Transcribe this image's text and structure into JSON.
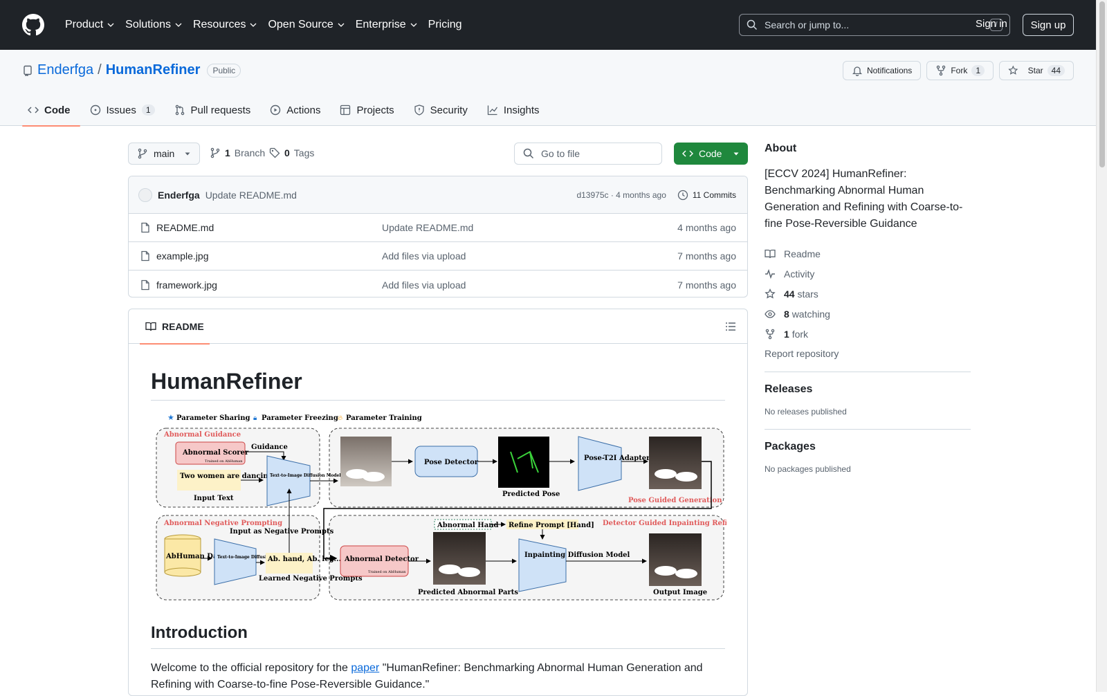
{
  "header": {
    "nav": [
      "Product",
      "Solutions",
      "Resources",
      "Open Source",
      "Enterprise",
      "Pricing"
    ],
    "search_placeholder": "Search or jump to...",
    "search_kbd": "/",
    "signin": "Sign in",
    "signup": "Sign up"
  },
  "repo": {
    "owner": "Enderfga",
    "name": "HumanRefiner",
    "visibility": "Public",
    "notifications_label": "Notifications",
    "fork_label": "Fork",
    "fork_count": "1",
    "star_label": "Star",
    "star_count": "44",
    "tabs": [
      {
        "label": "Code",
        "count": ""
      },
      {
        "label": "Issues",
        "count": "1"
      },
      {
        "label": "Pull requests",
        "count": ""
      },
      {
        "label": "Actions",
        "count": ""
      },
      {
        "label": "Projects",
        "count": ""
      },
      {
        "label": "Security",
        "count": ""
      },
      {
        "label": "Insights",
        "count": ""
      }
    ]
  },
  "branch": {
    "name": "main",
    "branch_count": "1",
    "branch_label": "Branch",
    "tag_count": "0",
    "tag_label": "Tags",
    "goto_placeholder": "Go to file",
    "code_label": "Code"
  },
  "latest_commit": {
    "author": "Enderfga",
    "message": "Update README.md",
    "hash_time": "d13975c · 4 months ago",
    "commits_count": "11 Commits"
  },
  "files": [
    {
      "name": "README.md",
      "commit": "Update README.md",
      "date": "4 months ago"
    },
    {
      "name": "example.jpg",
      "commit": "Add files via upload",
      "date": "7 months ago"
    },
    {
      "name": "framework.jpg",
      "commit": "Add files via upload",
      "date": "7 months ago"
    }
  ],
  "readme": {
    "tab_label": "README",
    "title": "HumanRefiner",
    "figure": {
      "legend": [
        "Parameter Sharing",
        "Parameter Freezing",
        "Parameter Training"
      ],
      "sections": [
        "Abnormal Guidance",
        "Abnormal Negative Prompting",
        "Pose Guided Generation",
        "Detector Guided Inpainting Refine"
      ],
      "abnormal_scorer": "Abnormal Scorer",
      "trained_on": "Trained on AbHuman",
      "guidance": "Guidance",
      "input_text_value": "Two women are dancing, ballet",
      "input_text_label": "Input Text",
      "t2i_model": "Text-to-Image Diffusion Model",
      "pose_detector": "Pose Detector",
      "predicted_pose": "Predicted Pose",
      "adapter": "Pose-T2I Adapter",
      "dataset": "AbHuman Dataset",
      "neg_input": "Input as Negative Prompts",
      "neg_learned_value": "Ab. hand, Ab. leg...",
      "neg_learned_label": "Learned Negative Prompts",
      "abnormal_hand": "Abnormal Hand",
      "refine_prompt": "Refine Prompt [Hand]",
      "abnormal_detector": "Abnormal Detector",
      "predicted_parts": "Predicted Abnormal Parts",
      "inpainting": "Inpainting Diffusion Model",
      "output": "Output Image"
    },
    "intro_heading": "Introduction",
    "intro_prefix": "Welcome to the official repository for the ",
    "intro_link": "paper",
    "intro_suffix": " \"HumanRefiner: Benchmarking Abnormal Human Generation and Refining with Coarse-to-fine Pose-Reversible Guidance.\""
  },
  "about": {
    "heading": "About",
    "description": "[ECCV 2024] HumanRefiner: Benchmarking Abnormal Human Generation and Refining with Coarse-to-fine Pose-Reversible Guidance",
    "readme": "Readme",
    "activity": "Activity",
    "stars_count": "44",
    "stars_label": "stars",
    "watching_count": "8",
    "watching_label": "watching",
    "fork_count": "1",
    "fork_label": "fork",
    "report": "Report repository"
  },
  "releases": {
    "heading": "Releases",
    "empty": "No releases published"
  },
  "packages": {
    "heading": "Packages",
    "empty": "No packages published"
  },
  "colors": {
    "accent": "#0969da",
    "green": "#1f883d",
    "tab_underline": "#fd8c73"
  }
}
